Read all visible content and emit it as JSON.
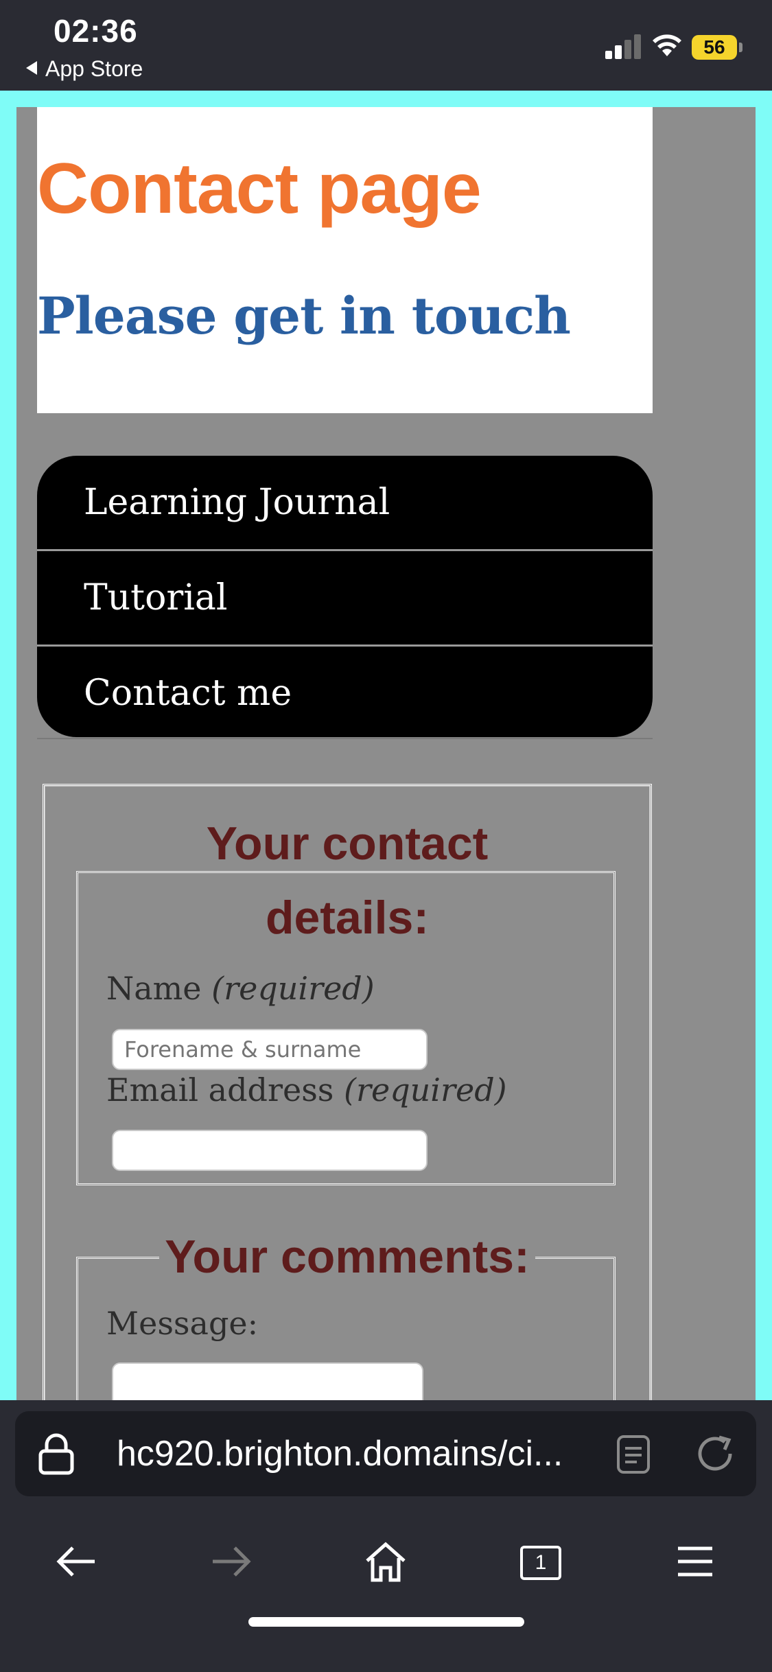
{
  "status_bar": {
    "time": "02:36",
    "back_app": "App Store",
    "battery": "56"
  },
  "page": {
    "title": "Contact page",
    "subtitle": "Please get in touch",
    "nav": [
      {
        "label": "Learning Journal"
      },
      {
        "label": "Tutorial"
      },
      {
        "label": "Contact me"
      }
    ],
    "form": {
      "details_legend_line1": "Your contact",
      "details_legend_line2": "details:",
      "name_label": "Name",
      "name_required": "(required)",
      "name_placeholder": "Forename & surname",
      "email_label": "Email address",
      "email_required": "(required)",
      "comments_legend": "Your comments:",
      "message_label": "Message:"
    }
  },
  "browser": {
    "url": "hc920.brighton.domains/ci...",
    "tab_count": "1"
  },
  "colors": {
    "title": "#f07430",
    "subtitle": "#2a5fa0",
    "legend": "#5e1c1c",
    "page_bg": "#8d8d8d",
    "viewport_bg": "#7ffcf7"
  },
  "icons": [
    "signal-icon",
    "wifi-icon",
    "lock-icon",
    "reader-mode-icon",
    "reload-icon",
    "back-arrow-icon",
    "forward-arrow-icon",
    "home-icon",
    "tabs-icon",
    "menu-icon"
  ]
}
